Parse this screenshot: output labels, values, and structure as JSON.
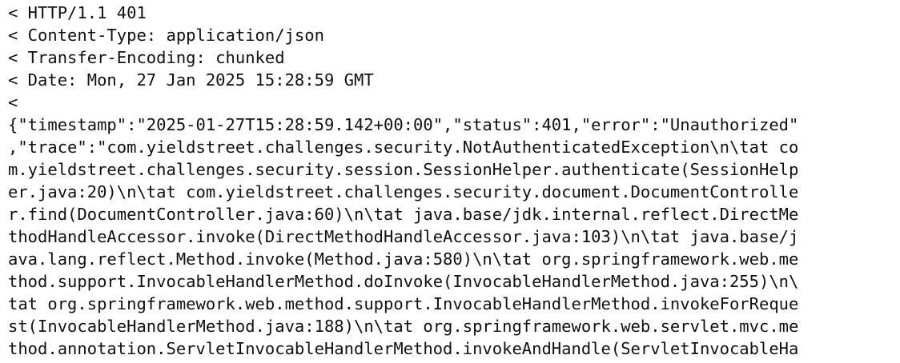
{
  "terminal": {
    "lines": [
      "< HTTP/1.1 401",
      "< Content-Type: application/json",
      "< Transfer-Encoding: chunked",
      "< Date: Mon, 27 Jan 2025 15:28:59 GMT",
      "<",
      "{\"timestamp\":\"2025-01-27T15:28:59.142+00:00\",\"status\":401,\"error\":\"Unauthorized\"",
      ",\"trace\":\"com.yieldstreet.challenges.security.NotAuthenticatedException\\n\\tat co",
      "m.yieldstreet.challenges.security.session.SessionHelper.authenticate(SessionHelp",
      "er.java:20)\\n\\tat com.yieldstreet.challenges.security.document.DocumentControlle",
      "r.find(DocumentController.java:60)\\n\\tat java.base/jdk.internal.reflect.DirectMe",
      "thodHandleAccessor.invoke(DirectMethodHandleAccessor.java:103)\\n\\tat java.base/j",
      "ava.lang.reflect.Method.invoke(Method.java:580)\\n\\tat org.springframework.web.me",
      "thod.support.InvocableHandlerMethod.doInvoke(InvocableHandlerMethod.java:255)\\n\\",
      "tat org.springframework.web.method.support.InvocableHandlerMethod.invokeForReque",
      "st(InvocableHandlerMethod.java:188)\\n\\tat org.springframework.web.servlet.mvc.me",
      "thod.annotation.ServletInvocableHandlerMethod.invokeAndHandle(ServletInvocableHa"
    ]
  }
}
